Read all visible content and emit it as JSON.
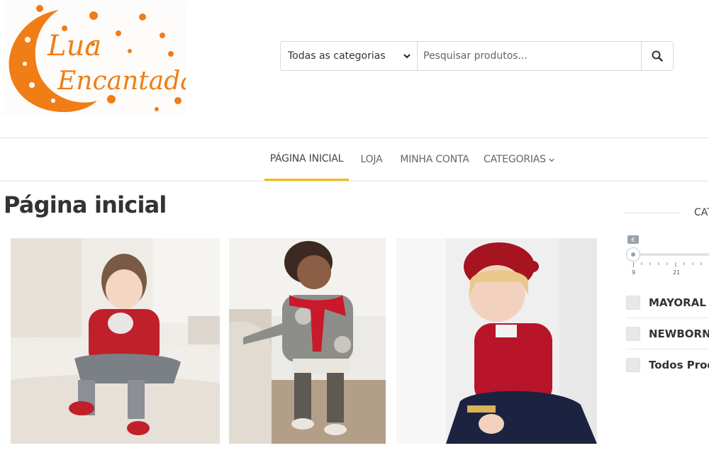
{
  "brand": {
    "line1": "Lua",
    "line2": "Encantada",
    "colors": {
      "orange": "#f07d16",
      "accent": "#f5b915"
    }
  },
  "search": {
    "category_selected": "Todas as categorias",
    "placeholder": "Pesquisar produtos...",
    "button_icon": "search-icon"
  },
  "nav": {
    "items": [
      {
        "label": "PÁGINA INICIAL"
      },
      {
        "label": "LOJA"
      },
      {
        "label": "MINHA CONTA"
      },
      {
        "label": "CATEGORIAS"
      }
    ],
    "active_index": 0
  },
  "page": {
    "title": "Página inicial"
  },
  "sidebar": {
    "heading": "CAT",
    "price_badge": "€",
    "price_ticks": [
      "9",
      "21"
    ],
    "filters": [
      {
        "label": "MAYORAL"
      },
      {
        "label": "NEWBORN"
      },
      {
        "label": "Todos Produ"
      }
    ]
  }
}
